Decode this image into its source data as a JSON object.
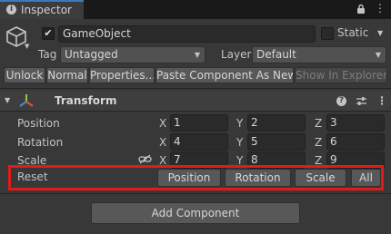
{
  "tab": {
    "title": "Inspector"
  },
  "header": {
    "object_name": "GameObject",
    "active": true,
    "static_label": "Static",
    "static_checked": false,
    "tag_label": "Tag",
    "tag_value": "Untagged",
    "layer_label": "Layer",
    "layer_value": "Default"
  },
  "toolbar": {
    "unlock": "Unlock",
    "normal": "Normal",
    "properties": "Properties...",
    "paste_component": "Paste Component As New",
    "show_in_explorer": "Show In Explorer"
  },
  "transform": {
    "title": "Transform",
    "rows": [
      {
        "label": "Position",
        "x": "1",
        "y": "2",
        "z": "3"
      },
      {
        "label": "Rotation",
        "x": "4",
        "y": "5",
        "z": "6"
      },
      {
        "label": "Scale",
        "x": "7",
        "y": "8",
        "z": "9"
      }
    ],
    "axes": {
      "x": "X",
      "y": "Y",
      "z": "Z"
    },
    "reset": {
      "label": "Reset",
      "buttons": {
        "position": "Position",
        "rotation": "Rotation",
        "scale": "Scale",
        "all": "All"
      }
    }
  },
  "add_component": "Add Component",
  "colors": {
    "background": "#383838",
    "highlight": "#e11b1b",
    "tab_accent": "#3a79bb",
    "field": "#2a2a2a",
    "button": "#585858"
  },
  "icons": [
    "info-icon",
    "lock-icon",
    "kebab-menu-icon",
    "gameobject-cube-icon",
    "transform-gizmo-icon",
    "help-icon",
    "preset-icon",
    "link-icon",
    "fold-arrow-icon"
  ]
}
